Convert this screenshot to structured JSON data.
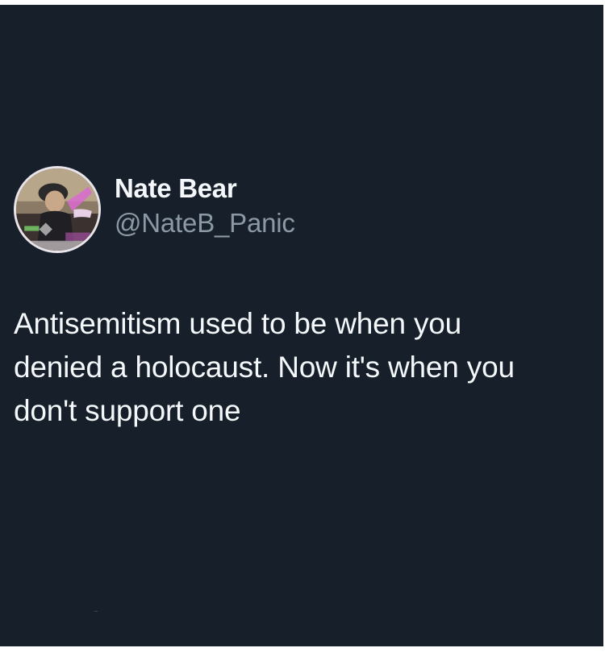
{
  "tweet": {
    "author": {
      "display_name": "Nate Bear",
      "handle": "@NateB_Panic",
      "avatar_icon": "profile-photo"
    },
    "text_lines": [
      "Antisemitism used to be when you",
      "denied a holocaust. Now it's when you",
      "don't support one"
    ]
  },
  "colors": {
    "background": "#17202a",
    "primary_text": "#f5f8fa",
    "secondary_text": "#8b98a5"
  }
}
